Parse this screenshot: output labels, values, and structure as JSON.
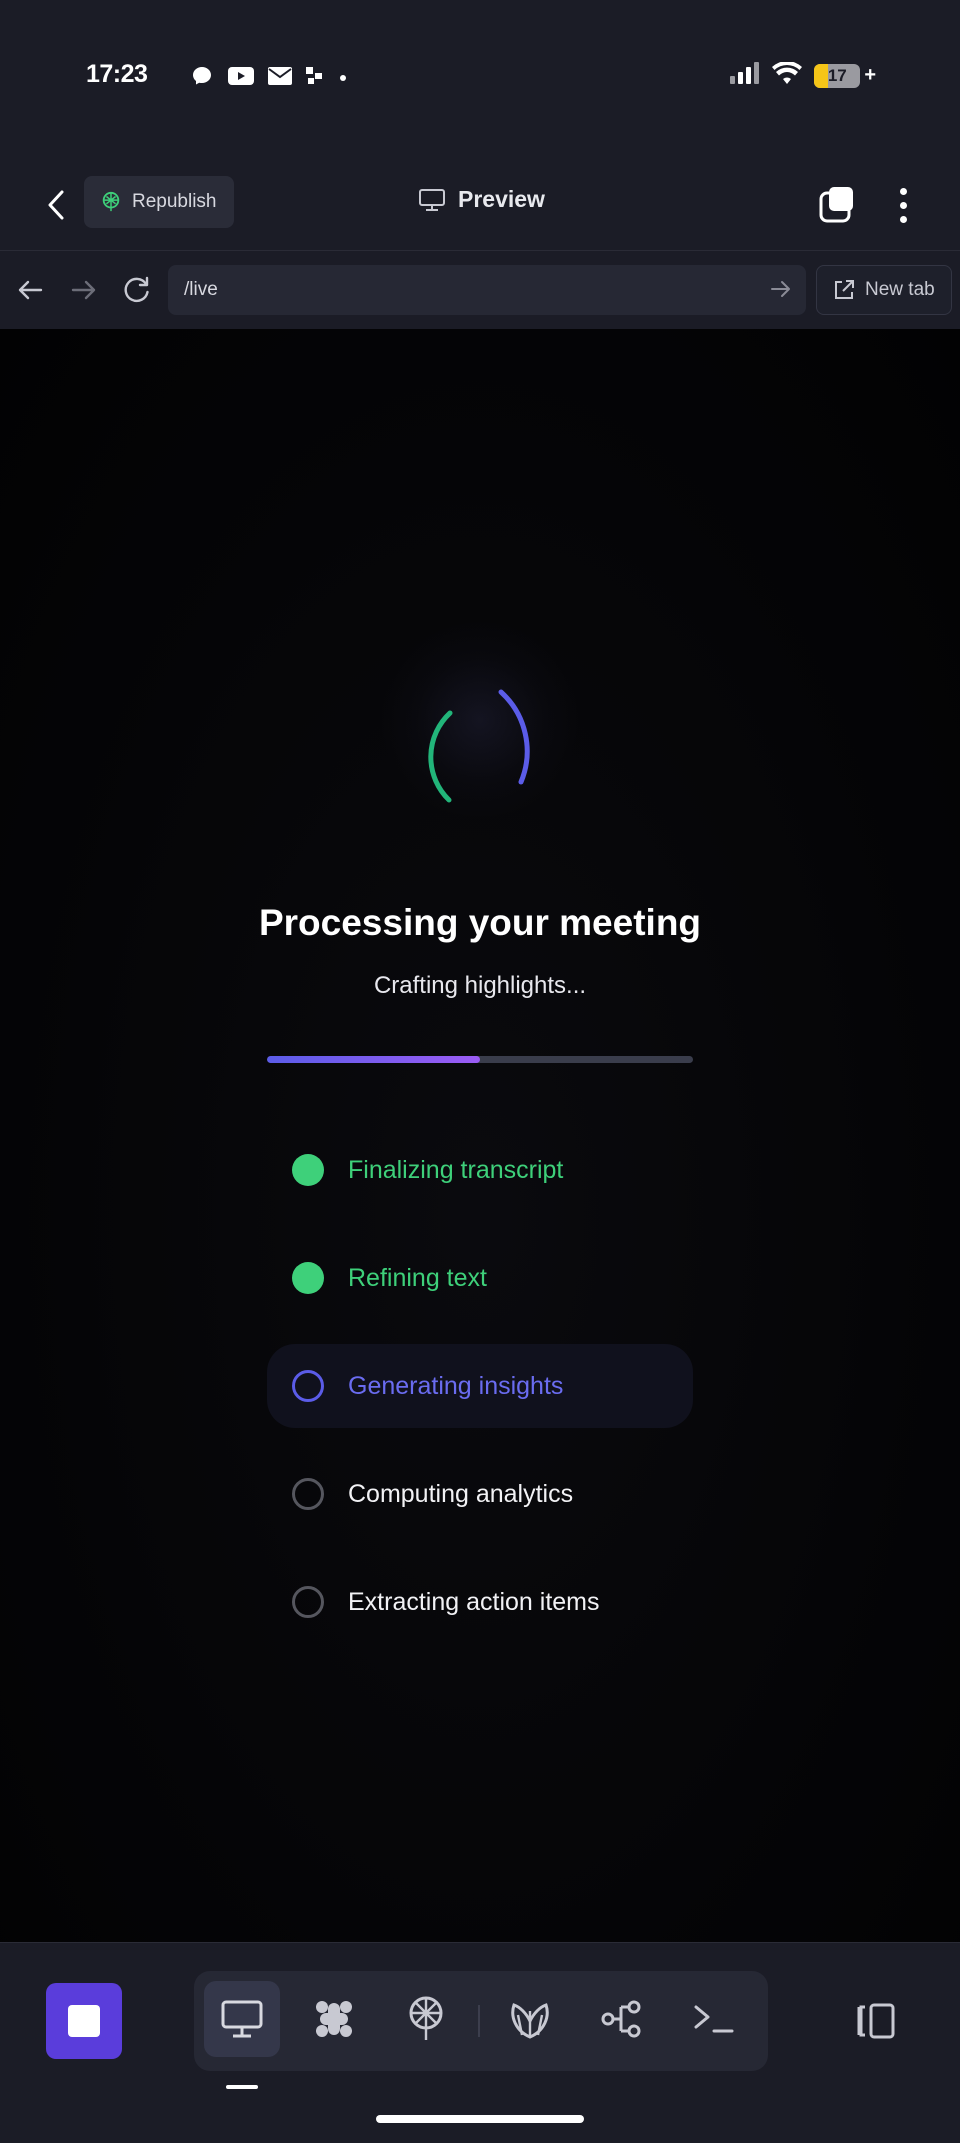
{
  "status_bar": {
    "time": "17:23",
    "notification_icons": [
      "messenger-icon",
      "youtube-icon",
      "mail-icon",
      "app-icon",
      "dot-icon"
    ],
    "battery_level": "17"
  },
  "app_bar": {
    "republish_label": "Republish",
    "preview_label": "Preview"
  },
  "url_bar": {
    "url": "/live",
    "new_tab_label": "New tab"
  },
  "processing": {
    "title": "Processing your meeting",
    "subtitle": "Crafting highlights...",
    "progress_fraction": 0.5,
    "steps": [
      {
        "label": "Finalizing transcript",
        "state": "done"
      },
      {
        "label": "Refining text",
        "state": "done"
      },
      {
        "label": "Generating insights",
        "state": "active"
      },
      {
        "label": "Computing analytics",
        "state": "pending"
      },
      {
        "label": "Extracting action items",
        "state": "pending"
      }
    ]
  },
  "colors": {
    "done": "#3ed07a",
    "active": "#5b5ce8",
    "accent_purple": "#5a3ddb",
    "background": "#1b1c26"
  },
  "bottom_bar": {
    "tools": [
      "desktop-icon",
      "apps-grid-icon",
      "publish-icon",
      "shell-icon",
      "workflow-icon",
      "terminal-icon"
    ],
    "selected_tool": "desktop-icon"
  }
}
